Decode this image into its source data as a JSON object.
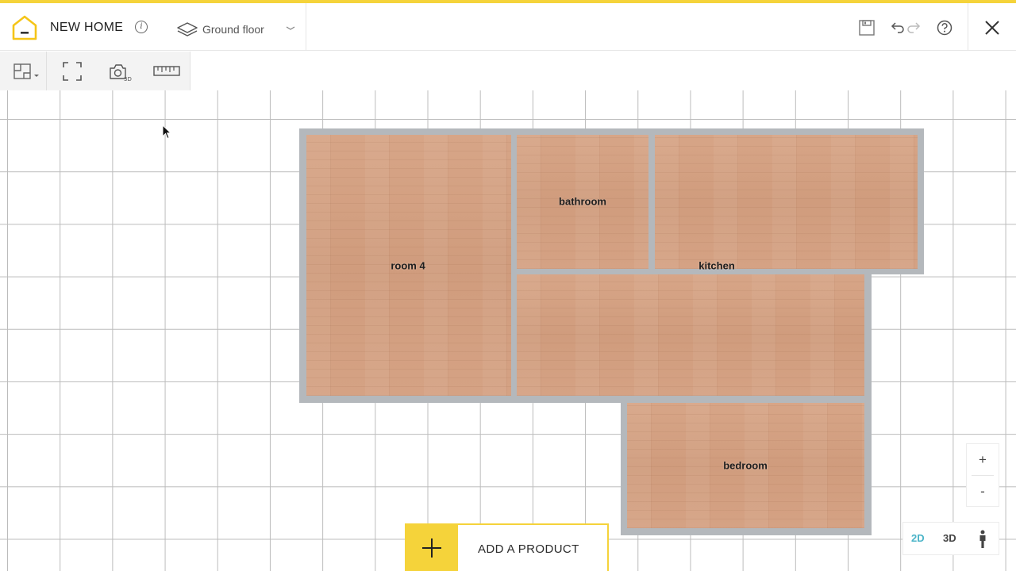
{
  "app": {
    "project_title": "NEW HOME",
    "accent_color": "#f5d33a"
  },
  "floor_selector": {
    "label": "Ground floor"
  },
  "top_actions": {
    "icons": [
      "save-icon",
      "undo-icon",
      "redo-icon",
      "help-icon",
      "close-icon"
    ]
  },
  "toolbar": {
    "icons": [
      "floorplan-tools-icon",
      "fullscreen-icon",
      "camera-3d-icon",
      "ruler-icon"
    ],
    "camera_badge": "3D"
  },
  "floorplan": {
    "wall_color": "#b4b8bc",
    "floor_color": "#d4a182",
    "rooms": [
      {
        "name": "room 4"
      },
      {
        "name": "bathroom"
      },
      {
        "name": "kitchen"
      },
      {
        "name": "bedroom"
      }
    ]
  },
  "zoom": {
    "in_label": "+",
    "out_label": "-"
  },
  "view_modes": {
    "mode_2d": "2D",
    "mode_3d": "3D",
    "active": "2D",
    "active_color": "#4bb4c8"
  },
  "add_product": {
    "label": "ADD A PRODUCT"
  }
}
